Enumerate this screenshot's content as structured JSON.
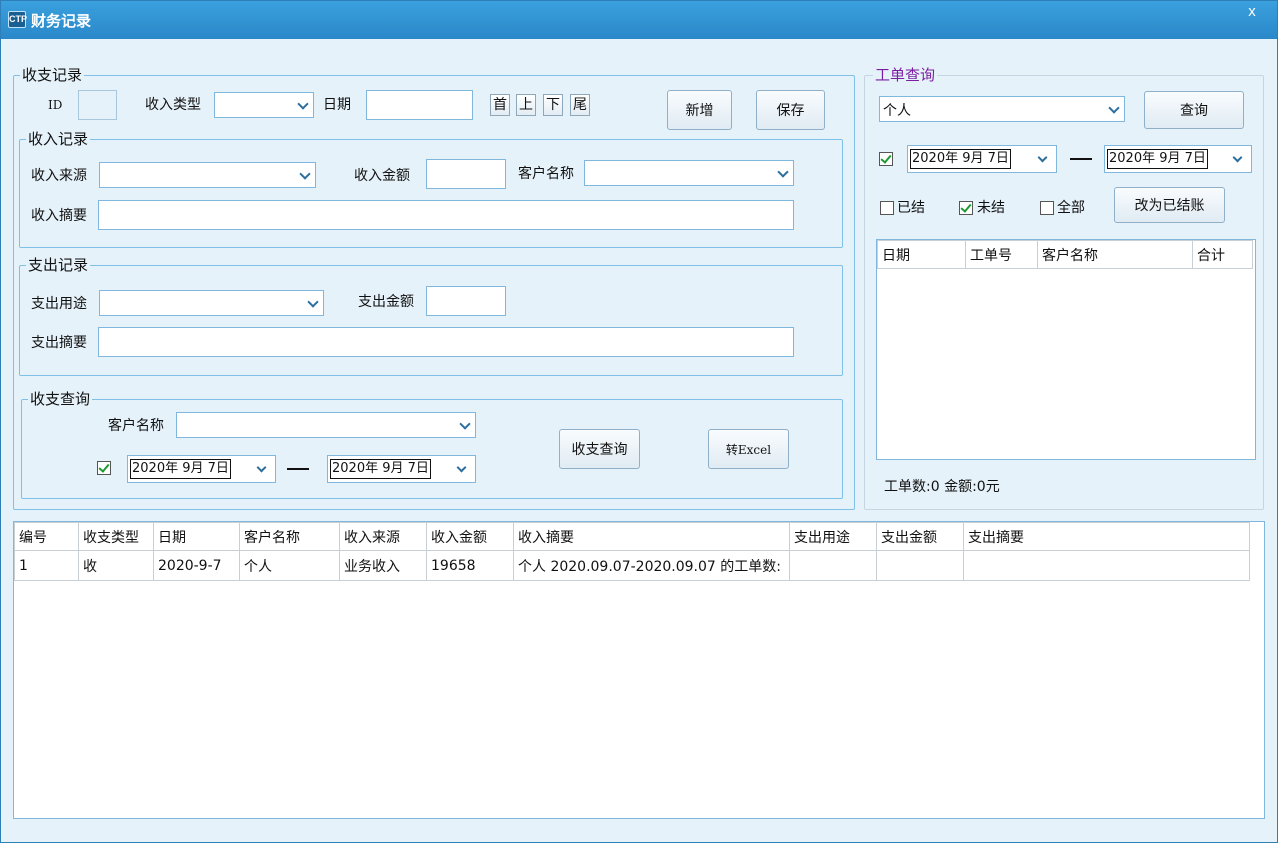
{
  "window": {
    "title": "财务记录",
    "icon": "app-icon",
    "icon_text": "CTP",
    "close": "x"
  },
  "record": {
    "title": "收支记录",
    "id_label": "ID",
    "income_type_label": "收入类型",
    "income_type_value": "",
    "date_label": "日期",
    "date_value": "",
    "nav": [
      "首",
      "上",
      "下",
      "尾"
    ],
    "add": "新增",
    "save": "保存"
  },
  "income": {
    "title": "收入记录",
    "source_label": "收入来源",
    "source_value": "",
    "amount_label": "收入金额",
    "amount_value": "",
    "customer_label": "客户名称",
    "customer_value": "",
    "summary_label": "收入摘要",
    "summary_value": ""
  },
  "expense": {
    "title": "支出记录",
    "use_label": "支出用途",
    "use_value": "",
    "amount_label": "支出金额",
    "amount_value": "",
    "summary_label": "支出摘要",
    "summary_value": ""
  },
  "query": {
    "title": "收支查询",
    "customer_label": "客户名称",
    "customer_value": "",
    "checked": true,
    "date_from": "2020年 9月 7日",
    "date_to": "2020年 9月 7日",
    "query_btn": "收支查询",
    "excel_btn": "转Excel"
  },
  "order_query": {
    "title": "工单查询",
    "type_value": "个人",
    "query_btn": "查询",
    "checked": true,
    "date_from": "2020年 9月 7日",
    "date_to": "2020年 9月 7日",
    "settled": "已结",
    "settled_checked": false,
    "unsettled": "未结",
    "unsettled_checked": true,
    "all": "全部",
    "all_checked": false,
    "mark_btn": "改为已结账",
    "columns": [
      "日期",
      "工单号",
      "客户名称",
      "合计"
    ],
    "summary": "工单数:0 金额:0元"
  },
  "main_table": {
    "columns": [
      "编号",
      "收支类型",
      "日期",
      "客户名称",
      "收入来源",
      "收入金额",
      "收入摘要",
      "支出用途",
      "支出金额",
      "支出摘要"
    ],
    "rows": [
      [
        "1",
        "收",
        "2020-9-7",
        "个人",
        "业务收入",
        "19658",
        "个人 2020.09.07-2020.09.07 的工单数:",
        "",
        "",
        ""
      ]
    ]
  }
}
